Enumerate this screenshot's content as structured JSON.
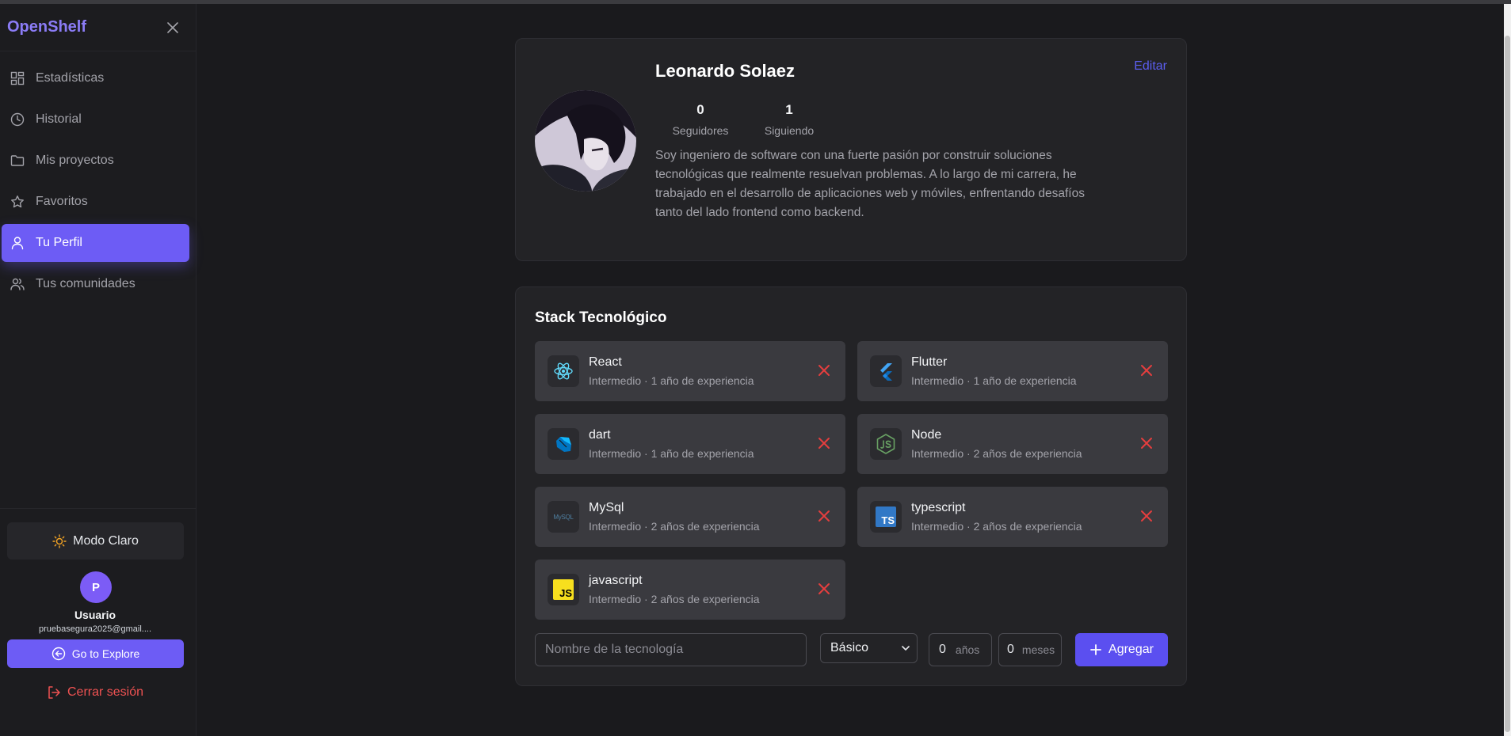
{
  "app": {
    "brand": "OpenShelf"
  },
  "sidebar": {
    "items": [
      {
        "label": "Estadísticas",
        "icon": "dashboard-icon"
      },
      {
        "label": "Historial",
        "icon": "clock-icon"
      },
      {
        "label": "Mis proyectos",
        "icon": "folder-icon"
      },
      {
        "label": "Favoritos",
        "icon": "star-icon"
      },
      {
        "label": "Tu Perfil",
        "icon": "user-icon",
        "active": true
      },
      {
        "label": "Tus comunidades",
        "icon": "users-icon"
      }
    ],
    "theme_label": "Modo Claro",
    "avatar_initial": "P",
    "user_name": "Usuario",
    "user_email": "pruebasegura2025@gmail....",
    "explore_label": "Go to Explore",
    "logout_label": "Cerrar sesión"
  },
  "profile": {
    "name": "Leonardo Solaez",
    "edit_label": "Editar",
    "followers_count": "0",
    "followers_label": "Seguidores",
    "following_count": "1",
    "following_label": "Siguiendo",
    "bio": "Soy ingeniero de software con una fuerte pasión por construir soluciones tecnológicas que realmente resuelvan problemas. A lo largo de mi carrera, he trabajado en el desarrollo de aplicaciones web y móviles, enfrentando desafíos tanto del lado frontend como backend."
  },
  "stack": {
    "title": "Stack Tecnológico",
    "items": [
      {
        "name": "React",
        "desc": "Intermedio · 1 año de experiencia",
        "icon": "react-icon"
      },
      {
        "name": "Flutter",
        "desc": "Intermedio · 1 año de experiencia",
        "icon": "flutter-icon"
      },
      {
        "name": "dart",
        "desc": "Intermedio · 1 año de experiencia",
        "icon": "dart-icon"
      },
      {
        "name": "Node",
        "desc": "Intermedio · 2 años de experiencia",
        "icon": "nodejs-icon"
      },
      {
        "name": "MySql",
        "desc": "Intermedio · 2 años de experiencia",
        "icon": "mysql-icon"
      },
      {
        "name": "typescript",
        "desc": "Intermedio · 2 años de experiencia",
        "icon": "typescript-icon"
      },
      {
        "name": "javascript",
        "desc": "Intermedio · 2 años de experiencia",
        "icon": "javascript-icon"
      }
    ],
    "form": {
      "name_placeholder": "Nombre de la tecnología",
      "level_value": "Básico",
      "years_value": "0",
      "years_unit": "años",
      "months_value": "0",
      "months_unit": "meses",
      "add_label": "Agregar"
    },
    "icon_texts": {
      "mysql": "MySQL",
      "typescript": "TS",
      "javascript": "JS"
    }
  },
  "colors": {
    "accent": "#6d5cf5",
    "danger": "#e53e3e",
    "link": "#5b5ef0"
  }
}
